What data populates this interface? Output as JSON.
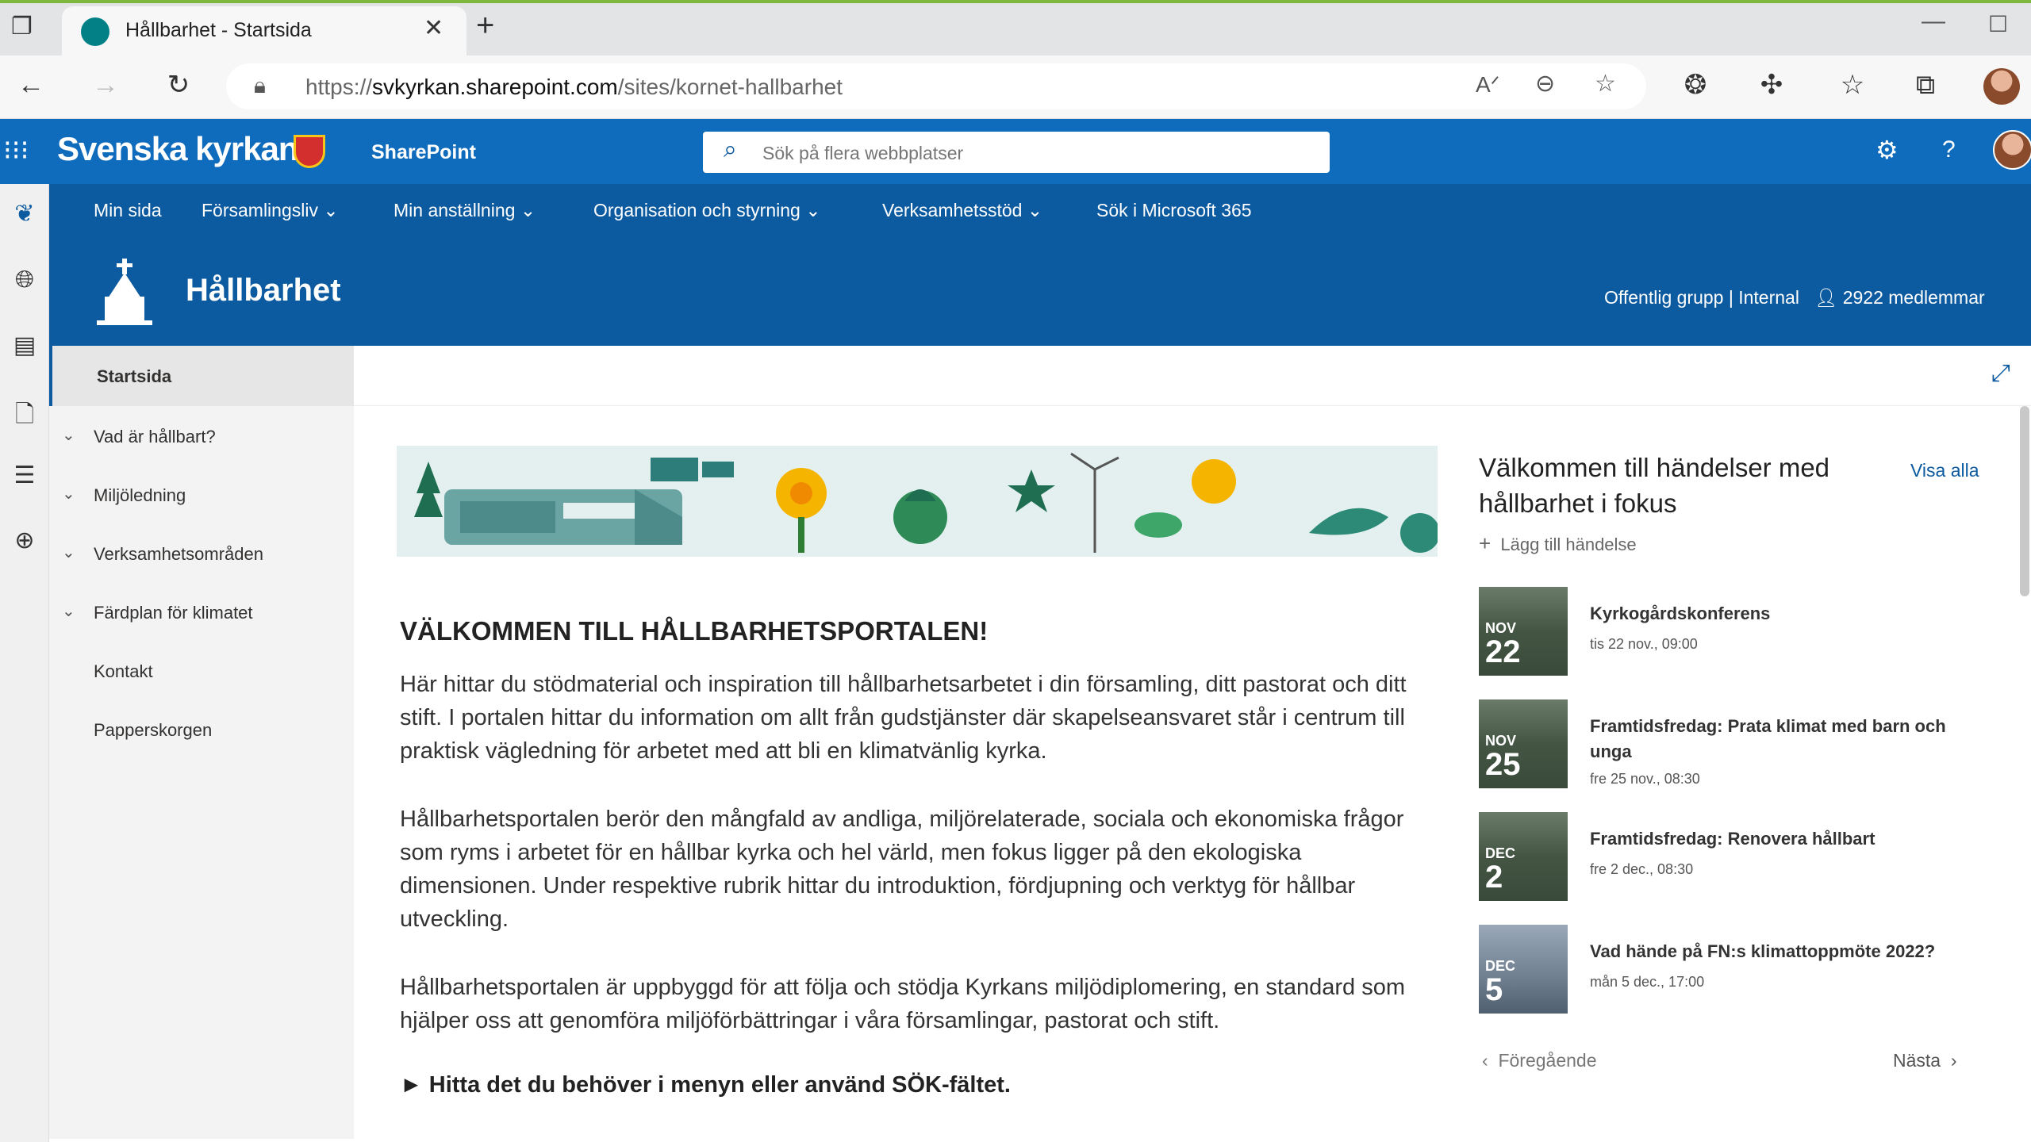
{
  "browser": {
    "tab_title": "Hållbarhet - Startsida",
    "url_prefix": "https://",
    "url_host": "svkyrkan.sharepoint.com",
    "url_path": "/sites/kornet-hallbarhet"
  },
  "suite": {
    "brand": "Svenska kyrkan",
    "app": "SharePoint",
    "search_placeholder": "Sök på flera webbplatser"
  },
  "hub_nav": [
    {
      "label": "Min sida",
      "has_menu": false
    },
    {
      "label": "Församlingsliv",
      "has_menu": true
    },
    {
      "label": "Min anställning",
      "has_menu": true
    },
    {
      "label": "Organisation och styrning",
      "has_menu": true
    },
    {
      "label": "Verksamhetsstöd",
      "has_menu": true
    },
    {
      "label": "Sök i Microsoft 365",
      "has_menu": false
    }
  ],
  "site": {
    "title": "Hållbarhet",
    "meta": "Offentlig grupp | Internal",
    "members": "2922 medlemmar"
  },
  "left_nav": [
    {
      "label": "Startsida",
      "expandable": false
    },
    {
      "label": "Vad är hållbart?",
      "expandable": true
    },
    {
      "label": "Miljöledning",
      "expandable": true
    },
    {
      "label": "Verksamhetsområden",
      "expandable": true
    },
    {
      "label": "Färdplan för klimatet",
      "expandable": true
    },
    {
      "label": "Kontakt",
      "expandable": false
    },
    {
      "label": "Papperskorgen",
      "expandable": false
    }
  ],
  "content": {
    "heading": "VÄLKOMMEN TILL HÅLLBARHETSPORTALEN!",
    "para1": "Här hittar du stödmaterial och inspiration till hållbarhetsarbetet i din församling, ditt pastorat och ditt stift. I portalen hittar du information om allt från gudstjänster där skapelseansvaret står i centrum till praktisk vägledning för arbetet med att bli en klimatvänlig kyrka.",
    "para2": "Hållbarhetsportalen berör den mångfald av andliga, miljörelaterade, sociala och ekonomiska frågor som ryms i arbetet för en hållbar kyrka och hel värld, men fokus ligger på den ekologiska dimensionen. Under respektive rubrik hittar du introduktion, fördjupning och verktyg för hållbar utveckling.",
    "para3": "Hållbarhetsportalen är uppbyggd för att följa och stödja Kyrkans miljödiplomering, en standard som hjälper oss att genomföra miljöförbättringar i våra församlingar, pastorat och stift.",
    "cta": "► Hitta det du behöver i menyn eller använd SÖK-fältet."
  },
  "events": {
    "title": "Välkommen till händelser med hållbarhet i fokus",
    "view_all": "Visa alla",
    "add": "Lägg till händelse",
    "items": [
      {
        "month": "NOV",
        "day": "22",
        "title": "Kyrkogårdskonferens",
        "date": "tis 22 nov., 09:00"
      },
      {
        "month": "NOV",
        "day": "25",
        "title": "Framtidsfredag: Prata klimat med barn och unga",
        "date": "fre 25 nov., 08:30"
      },
      {
        "month": "DEC",
        "day": "2",
        "title": "Framtidsfredag: Renovera hållbart",
        "date": "fre 2 dec., 08:30"
      },
      {
        "month": "DEC",
        "day": "5",
        "title": "Vad hände på FN:s klimattoppmöte 2022?",
        "date": "mån 5 dec., 17:00"
      }
    ],
    "prev": "Föregående",
    "next": "Nästa"
  },
  "colors": {
    "suite_blue": "#0f6cbd",
    "site_blue": "#0c5aa0"
  }
}
